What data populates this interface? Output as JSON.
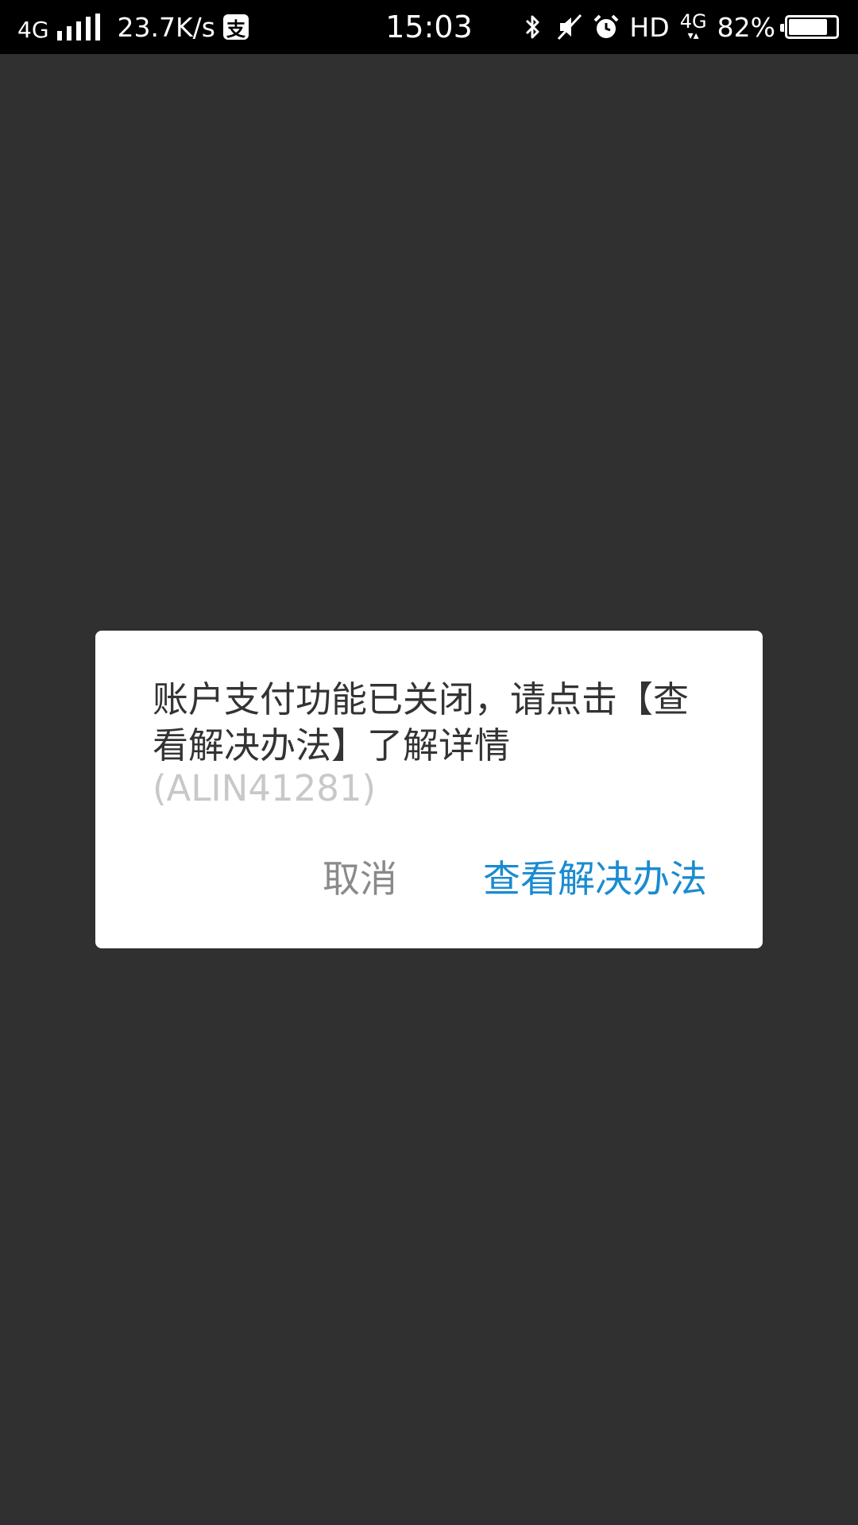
{
  "status_bar": {
    "network": "4G",
    "speed": "23.7K/s",
    "app_icon_glyph": "支",
    "time": "15:03",
    "right_network": "4G",
    "hd_label": "HD",
    "battery_percent_text": "82%",
    "battery_level": 0.82,
    "icons": [
      "signal-icon",
      "alipay-icon",
      "bluetooth-icon",
      "mute-icon",
      "alarm-icon",
      "battery-icon"
    ]
  },
  "dialog": {
    "message": "账户支付功能已关闭，请点击【查看解决办法】了解详情",
    "code": "(ALIN41281)",
    "cancel_label": "取消",
    "solution_label": "查看解决办法"
  },
  "colors": {
    "overlay": "#303030",
    "status_bar": "#000000",
    "primary_action": "#1a8bd1",
    "secondary_action": "#8a8a8a",
    "code_text": "#c8c8c8"
  }
}
